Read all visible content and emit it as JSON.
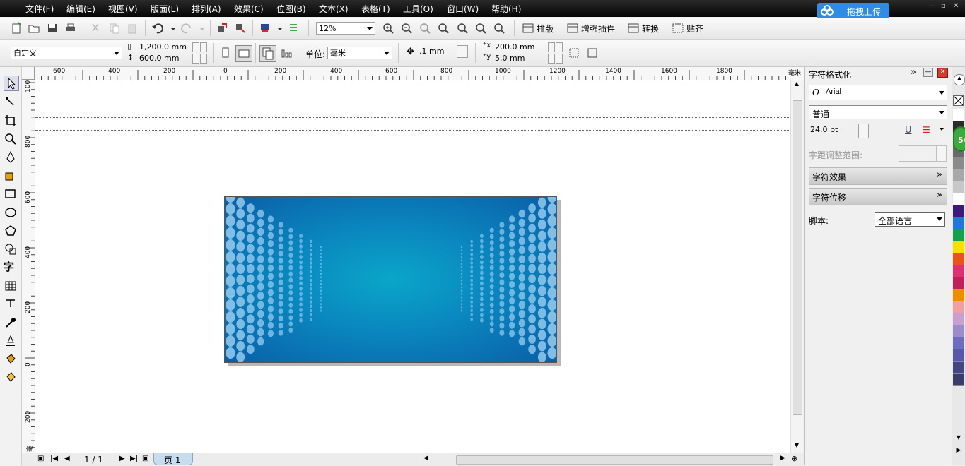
{
  "menubar": {
    "items": [
      "文件(F)",
      "编辑(E)",
      "视图(V)",
      "版面(L)",
      "排列(A)",
      "效果(C)",
      "位图(B)",
      "文本(X)",
      "表格(T)",
      "工具(O)",
      "窗口(W)",
      "帮助(H)"
    ],
    "upload_label": "拖拽上传"
  },
  "toolbar1": {
    "zoom_value": "12%",
    "plugin_buttons": [
      "排版",
      "增强插件",
      "转换",
      "贴齐"
    ]
  },
  "toolbar2": {
    "paper_preset": "自定义",
    "page_width": "1,200.0 mm",
    "page_height": "600.0 mm",
    "units_label": "单位:",
    "units_value": "毫米",
    "nudge_value": ".1 mm",
    "dup_x": "200.0 mm",
    "dup_y": "5.0 mm"
  },
  "ruler": {
    "top_labels": [
      "600",
      "400",
      "200",
      "0",
      "200",
      "400",
      "600",
      "800",
      "1000",
      "1200",
      "1400",
      "1600",
      "1800"
    ],
    "top_unit": "毫米",
    "left_labels": [
      "100",
      "800",
      "600",
      "400",
      "200",
      "0",
      "200"
    ],
    "left_unit": "毫米"
  },
  "statusbar": {
    "page_counter": "1 / 1",
    "page_tab": "页 1"
  },
  "docker": {
    "title": "字符格式化",
    "font_name": "Arial",
    "font_style": "普通",
    "font_size": "24.0 pt",
    "kerning_label": "字距调整范围:",
    "section_effects": "字符效果",
    "section_offset": "字符位移",
    "script_label": "脚本:",
    "script_value": "全部语言"
  },
  "palette": {
    "colors": [
      "#ffffff",
      "#2a2a2a",
      "#4a4a4a",
      "#6a6a6a",
      "#8a8a8a",
      "#a8a8a8",
      "#c8c8c8",
      "#ffffff",
      "#3c1a7a",
      "#1e7ad6",
      "#15a04a",
      "#f5e000",
      "#e8541a",
      "#e03070",
      "#c0205a",
      "#f08c00",
      "#f0a0a0",
      "#c8a0d0",
      "#9c8cc8",
      "#6c6cc0",
      "#5858a8",
      "#444488",
      "#3c3c6c"
    ],
    "badge": "54"
  }
}
